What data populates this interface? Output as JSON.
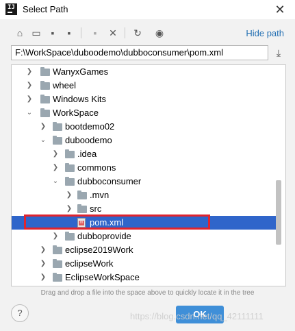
{
  "window": {
    "title": "Select Path",
    "app_icon_text": "IJ",
    "close_glyph": "✕"
  },
  "toolbar": {
    "icons": [
      "home-icon",
      "desktop-icon",
      "project-icon",
      "module-icon",
      "new-folder-icon",
      "delete-icon",
      "refresh-icon",
      "show-hidden-icon"
    ],
    "hide_path_label": "Hide path"
  },
  "path_field": {
    "value": "F:\\WorkSpace\\duboodemo\\dubboconsumer\\pom.xml"
  },
  "tree": {
    "rows": [
      {
        "label": "WanyxGames",
        "expanded": false,
        "type": "folder"
      },
      {
        "label": "wheel",
        "expanded": false,
        "type": "folder"
      },
      {
        "label": "Windows Kits",
        "expanded": false,
        "type": "folder"
      },
      {
        "label": "WorkSpace",
        "expanded": true,
        "type": "folder"
      },
      {
        "label": "bootdemo02",
        "expanded": false,
        "type": "folder"
      },
      {
        "label": "duboodemo",
        "expanded": true,
        "type": "folder"
      },
      {
        "label": ".idea",
        "expanded": false,
        "type": "folder"
      },
      {
        "label": "commons",
        "expanded": false,
        "type": "folder"
      },
      {
        "label": "dubboconsumer",
        "expanded": true,
        "type": "folder"
      },
      {
        "label": ".mvn",
        "expanded": false,
        "type": "folder"
      },
      {
        "label": "src",
        "expanded": false,
        "type": "folder"
      },
      {
        "label": "pom.xml",
        "type": "maven-file",
        "selected": true
      },
      {
        "label": "dubboprovide",
        "expanded": false,
        "type": "folder"
      },
      {
        "label": "eclipse2019Work",
        "expanded": false,
        "type": "folder"
      },
      {
        "label": "eclipseWork",
        "expanded": false,
        "type": "folder"
      },
      {
        "label": "EclipseWorkSpace",
        "expanded": false,
        "type": "folder"
      }
    ]
  },
  "hint_text": "Drag and drop a file into the space above to quickly locate it in the tree",
  "buttons": {
    "help_label": "?",
    "ok_label": "OK"
  },
  "watermark": "https://blog.csdn.net/qq_42111111",
  "colors": {
    "selection": "#2f65ca",
    "highlight_border": "#e0242e",
    "link": "#2470b3",
    "ok_button": "#3f8fd8"
  }
}
